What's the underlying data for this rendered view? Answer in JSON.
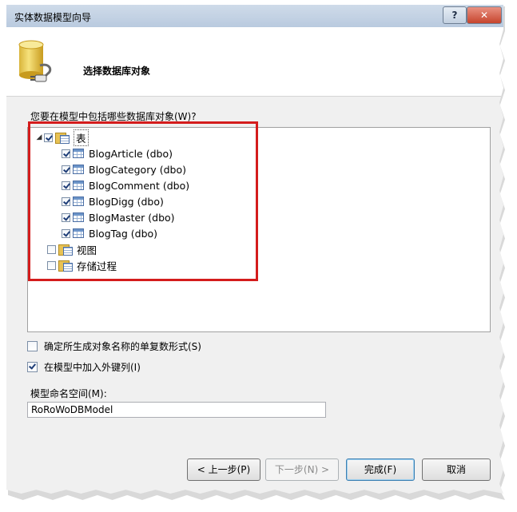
{
  "window": {
    "title": "实体数据模型向导",
    "help_label": "?",
    "close_label": "✕"
  },
  "header": {
    "title": "选择数据库对象",
    "icon": "database-plug-icon"
  },
  "question": "您要在模型中包括哪些数据库对象(W)?",
  "tree": {
    "root": {
      "label": "表",
      "checked": true,
      "expanded": true,
      "expander": "◢"
    },
    "tables": [
      {
        "label": "BlogArticle (dbo)",
        "checked": true
      },
      {
        "label": "BlogCategory (dbo)",
        "checked": true
      },
      {
        "label": "BlogComment (dbo)",
        "checked": true
      },
      {
        "label": "BlogDigg (dbo)",
        "checked": true
      },
      {
        "label": "BlogMaster (dbo)",
        "checked": true
      },
      {
        "label": "BlogTag (dbo)",
        "checked": true
      }
    ],
    "others": [
      {
        "label": "视图",
        "checked": false
      },
      {
        "label": "存储过程",
        "checked": false
      }
    ]
  },
  "options": {
    "pluralize": {
      "label": "确定所生成对象名称的单复数形式(S)",
      "checked": false
    },
    "foreign_keys": {
      "label": "在模型中加入外键列(I)",
      "checked": true
    }
  },
  "namespace": {
    "label": "模型命名空间(M):",
    "value": "RoRoWoDBModel"
  },
  "buttons": {
    "back": "< 上一步(P)",
    "next": "下一步(N) >",
    "finish": "完成(F)",
    "cancel": "取消"
  },
  "colors": {
    "highlight_box": "#d41c1c"
  }
}
